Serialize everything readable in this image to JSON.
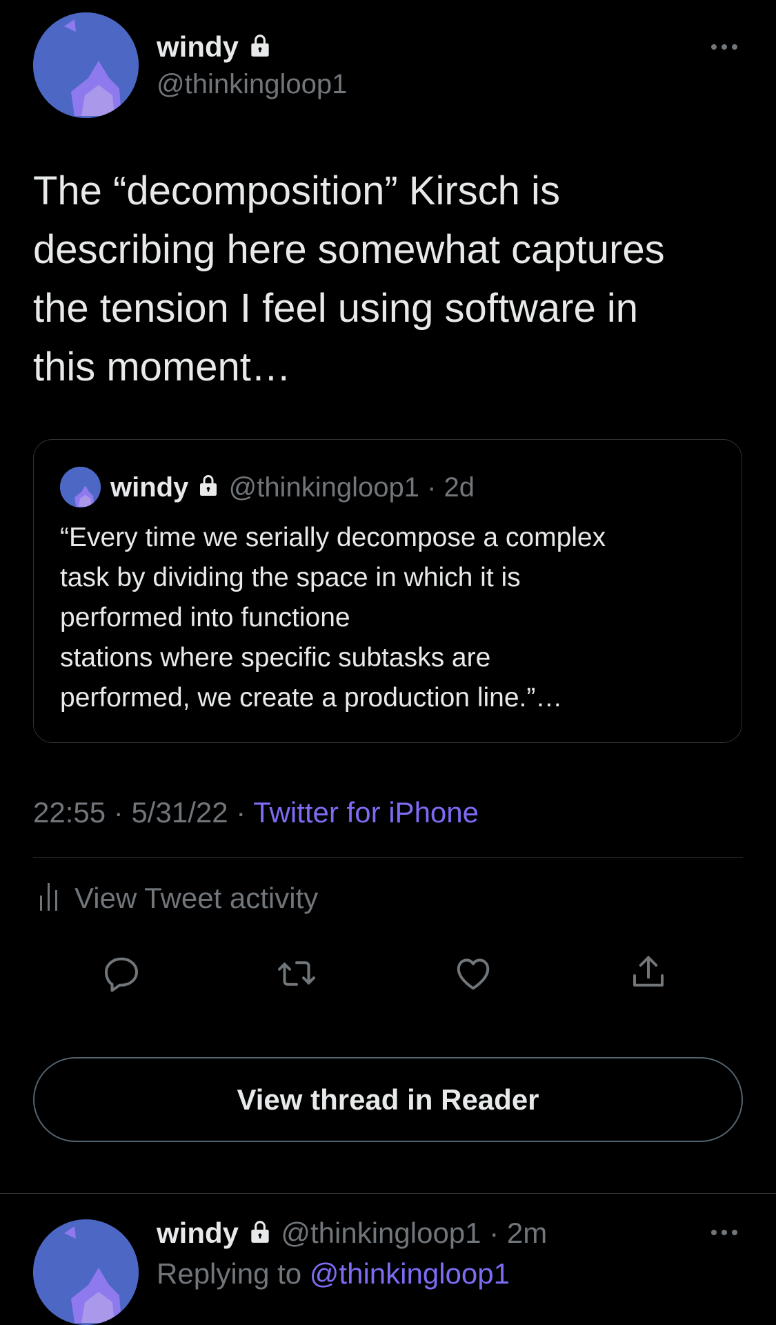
{
  "main_tweet": {
    "author_name": "windy",
    "author_handle": "@thinkingloop1",
    "text_lines": [
      "The “decomposition” Kirsch is",
      "describing here somewhat captures",
      "the tension I feel using software in",
      "this moment…"
    ],
    "quoted": {
      "author_name": "windy",
      "author_handle": "@thinkingloop1",
      "separator": "·",
      "time": "2d",
      "text_lines": [
        "“Every time we serially decompose a complex",
        "task by dividing the space in which it is",
        "performed into functione",
        "stations where specific subtasks are",
        "performed, we create a production line.”…"
      ]
    },
    "time": "22:55",
    "date": "5/31/22",
    "sep1": "·",
    "sep2": "·",
    "source": "Twitter for iPhone",
    "activity_label": "View Tweet activity",
    "reader_button": "View thread in Reader"
  },
  "reply": {
    "author_name": "windy",
    "author_handle": "@thinkingloop1",
    "separator": "·",
    "time": "2m",
    "replying_prefix": "Replying to",
    "replying_handle": "@thinkingloop1"
  },
  "icons": {
    "lock": "lock-icon",
    "more": "more-icon",
    "reply": "reply-icon",
    "retweet": "retweet-icon",
    "like": "like-icon",
    "share": "share-icon",
    "activity": "activity-chart-icon"
  },
  "colors": {
    "background": "#000000",
    "text": "#e7e9ea",
    "muted": "#71767b",
    "link": "#7c6cf3",
    "avatar": "#4d68c4"
  }
}
